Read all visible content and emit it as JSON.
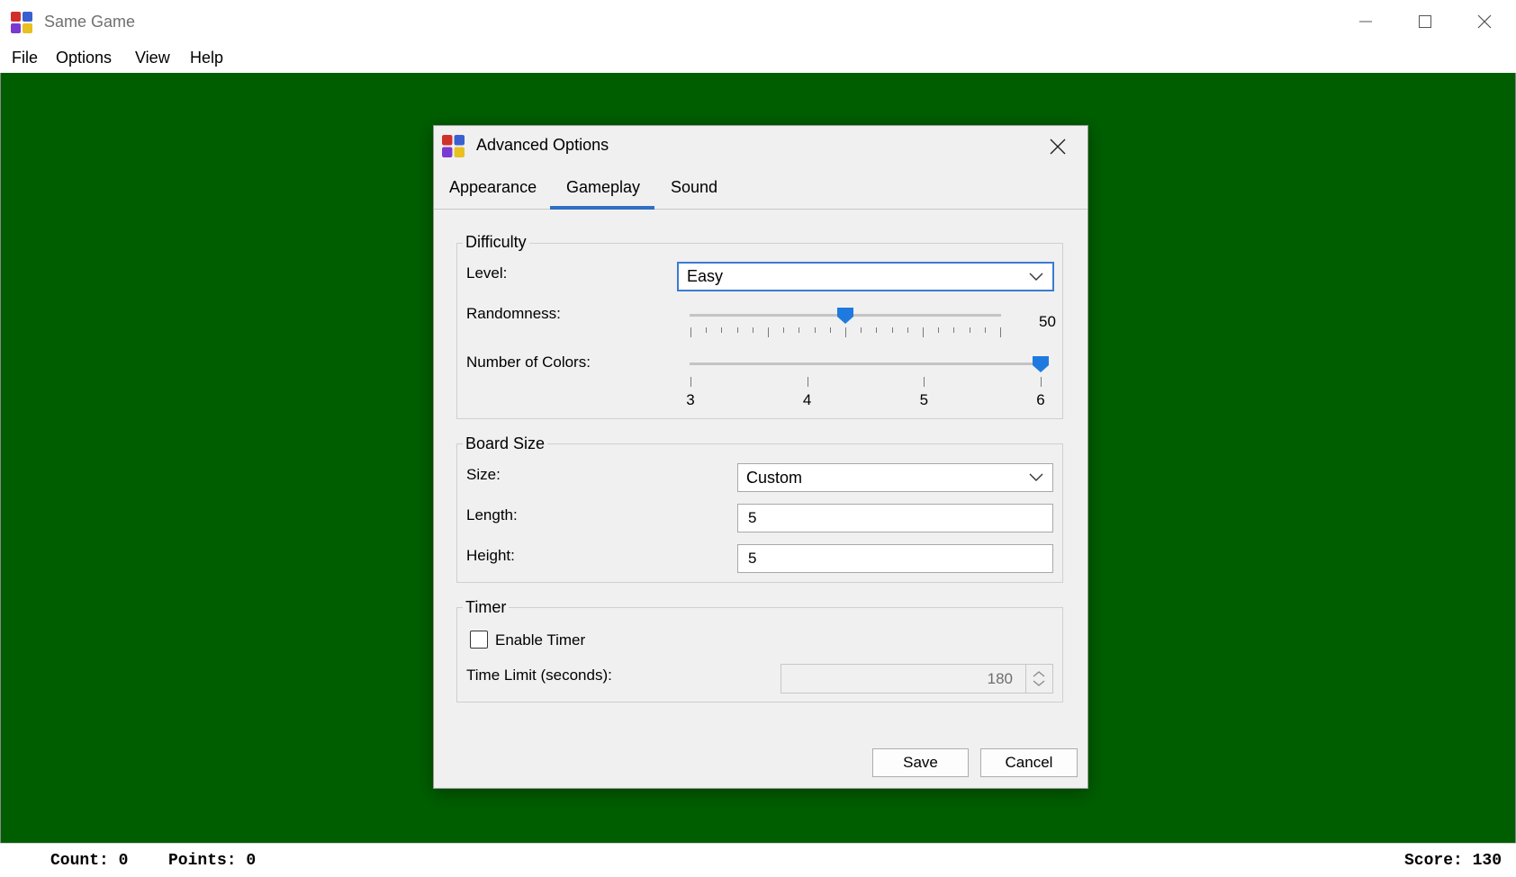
{
  "window": {
    "title": "Same Game",
    "icon": "app-blocks-icon"
  },
  "menu": {
    "items": [
      "File",
      "Options",
      "View",
      "Help"
    ]
  },
  "game": {
    "background": "#005e00"
  },
  "status": {
    "count": "Count: 0",
    "points": "Points: 0",
    "score": "Score: 130"
  },
  "dialog": {
    "title": "Advanced Options",
    "tabs": [
      "Appearance",
      "Gameplay",
      "Sound"
    ],
    "active_tab": "Gameplay",
    "difficulty": {
      "legend": "Difficulty",
      "level_label": "Level:",
      "level_value": "Easy",
      "randomness_label": "Randomness:",
      "randomness_value": "50",
      "randomness_min": 0,
      "randomness_max": 100,
      "colors_label": "Number of Colors:",
      "colors_ticks": [
        "3",
        "4",
        "5",
        "6"
      ],
      "colors_value": 6
    },
    "board": {
      "legend": "Board Size",
      "size_label": "Size:",
      "size_value": "Custom",
      "length_label": "Length:",
      "length_value": "5",
      "height_label": "Height:",
      "height_value": "5"
    },
    "timer": {
      "legend": "Timer",
      "enable_label": "Enable Timer",
      "enabled": false,
      "limit_label": "Time Limit (seconds):",
      "limit_value": "180"
    },
    "save_label": "Save",
    "cancel_label": "Cancel"
  },
  "colors": {
    "accent": "#2f6fc5",
    "thumb": "#1f7ae0"
  }
}
